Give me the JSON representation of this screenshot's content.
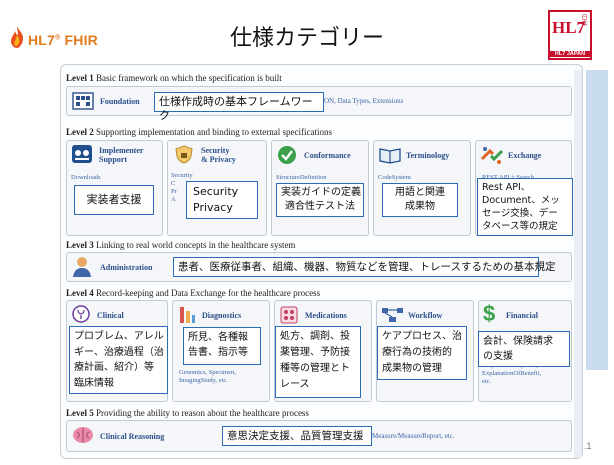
{
  "header": {
    "logo_text": "HL7",
    "logo_tm": "®",
    "logo_suffix": "FHIR",
    "title": "仕様カテゴリー",
    "hl7_japan": {
      "mark": "HL7",
      "jp": "日本",
      "sub": "HL7 JAPAN"
    }
  },
  "levels": [
    {
      "id": 1,
      "prefix": "Level 1",
      "description": "Basic framework on which the specification is built",
      "modules": [
        {
          "name": "Foundation",
          "icon": "foundation-icon",
          "faint_text": "ON, Data Types, Extensions"
        }
      ]
    },
    {
      "id": 2,
      "prefix": "Level 2",
      "description": "Supporting implementation and binding to external specifications",
      "modules": [
        {
          "name": "Implementer\nSupport",
          "icon": "implementer-support-icon",
          "faint_text": "Downloads"
        },
        {
          "name": "Security\n& Privacy",
          "icon": "security-privacy-icon",
          "faint_text": "Security\nC\nPr\nA"
        },
        {
          "name": "Conformance",
          "icon": "conformance-icon",
          "faint_text": "StructureDefinition"
        },
        {
          "name": "Terminology",
          "icon": "terminology-icon",
          "faint_text": "CodeSystem"
        },
        {
          "name": "Exchange",
          "icon": "exchange-icon",
          "faint_text": "REST API + Search"
        }
      ]
    },
    {
      "id": 3,
      "prefix": "Level 3",
      "description": "Linking to real world concepts in the healthcare system",
      "modules": [
        {
          "name": "Administration",
          "icon": "administration-icon",
          "faint_text": ""
        }
      ]
    },
    {
      "id": 4,
      "prefix": "Level 4",
      "description": "Record-keeping and Data Exchange for the healthcare process",
      "modules": [
        {
          "name": "Clinical",
          "icon": "clinical-icon",
          "faint_text": ""
        },
        {
          "name": "Diagnostics",
          "icon": "diagnostics-icon",
          "faint_text": "Genomics, Specimen,\nImagingStudy, etc."
        },
        {
          "name": "Medications",
          "icon": "medications-icon",
          "faint_text": ""
        },
        {
          "name": "Workflow",
          "icon": "workflow-icon",
          "faint_text": ""
        },
        {
          "name": "Financial",
          "icon": "financial-icon",
          "faint_text": "Request & Response,\nExplanationOfBenefit,\netc."
        }
      ]
    },
    {
      "id": 5,
      "prefix": "Level 5",
      "description": "Providing the ability to reason about the healthcare process",
      "modules": [
        {
          "name": "Clinical Reasoning",
          "icon": "clinical-reasoning-icon",
          "faint_text": "Measure/MeasureReport, etc."
        }
      ]
    }
  ],
  "overlays": {
    "foundation": "仕様作成時の基本フレームワーク",
    "implementer": "実装者支援",
    "security": "Security\nPrivacy",
    "conformance": "実装ガイドの定義\n適合性テスト法",
    "terminology": "用語と関連\n成果物",
    "exchange": "Rest API、\nDocument、メッ\nセージ交換、デー\nタベース等の規定",
    "administration": "患者、医療従事者、組織、機器、物質などを管理、トレースするための基本規定",
    "clinical": "プロブレム、アレル\nギー、治療過程（治\n療計画、紹介）等\n臨床情報",
    "diagnostics": "所見、各種報\n告書、指示等",
    "medications": "処方、調剤、投\n薬管理、予防接\n種等の管理とト\nレース",
    "workflow": "ケアプロセス、治\n療行為の技術的\n成果物の管理",
    "financial": "会計、保険請求\nの支援",
    "clinical_reasoning": "意思決定支援、品質管理支援"
  },
  "slide_number": ".1",
  "colors": {
    "overlay_border": "#2a6db5",
    "module_title": "#2a4f8a",
    "brand_orange": "#e07a1a",
    "hl7_red": "#c8102e"
  }
}
